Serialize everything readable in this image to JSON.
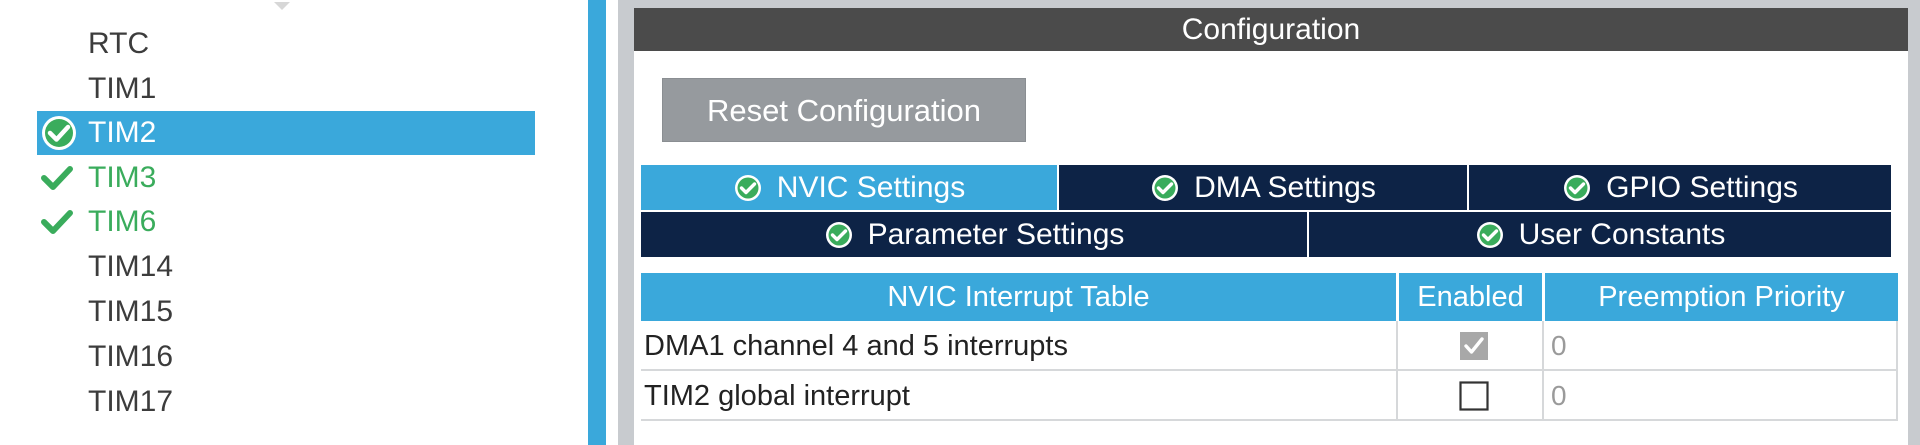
{
  "tree": {
    "items": [
      {
        "label": "RTC",
        "state": "normal"
      },
      {
        "label": "TIM1",
        "state": "normal"
      },
      {
        "label": "TIM2",
        "state": "selected"
      },
      {
        "label": "TIM3",
        "state": "configured"
      },
      {
        "label": "TIM6",
        "state": "configured"
      },
      {
        "label": "TIM14",
        "state": "normal"
      },
      {
        "label": "TIM15",
        "state": "normal"
      },
      {
        "label": "TIM16",
        "state": "normal"
      },
      {
        "label": "TIM17",
        "state": "normal"
      }
    ]
  },
  "config": {
    "title": "Configuration",
    "reset_label": "Reset Configuration",
    "tabs": [
      {
        "label": "NVIC Settings",
        "active": true
      },
      {
        "label": "DMA Settings",
        "active": false
      },
      {
        "label": "GPIO Settings",
        "active": false
      },
      {
        "label": "Parameter Settings",
        "active": false
      },
      {
        "label": "User Constants",
        "active": false
      }
    ]
  },
  "nvic_table": {
    "headers": [
      "NVIC Interrupt Table",
      "Enabled",
      "Preemption Priority"
    ],
    "rows": [
      {
        "name": "DMA1 channel 4 and 5 interrupts",
        "enabled": true,
        "enabled_locked": true,
        "priority": "0"
      },
      {
        "name": "TIM2 global interrupt",
        "enabled": false,
        "enabled_locked": false,
        "priority": "0"
      }
    ]
  },
  "colors": {
    "accent": "#3aa8db",
    "tab_dark": "#0d2346",
    "header_dark": "#4b4b4b",
    "configured_green": "#3aac5c",
    "button_grey": "#969a9e"
  }
}
